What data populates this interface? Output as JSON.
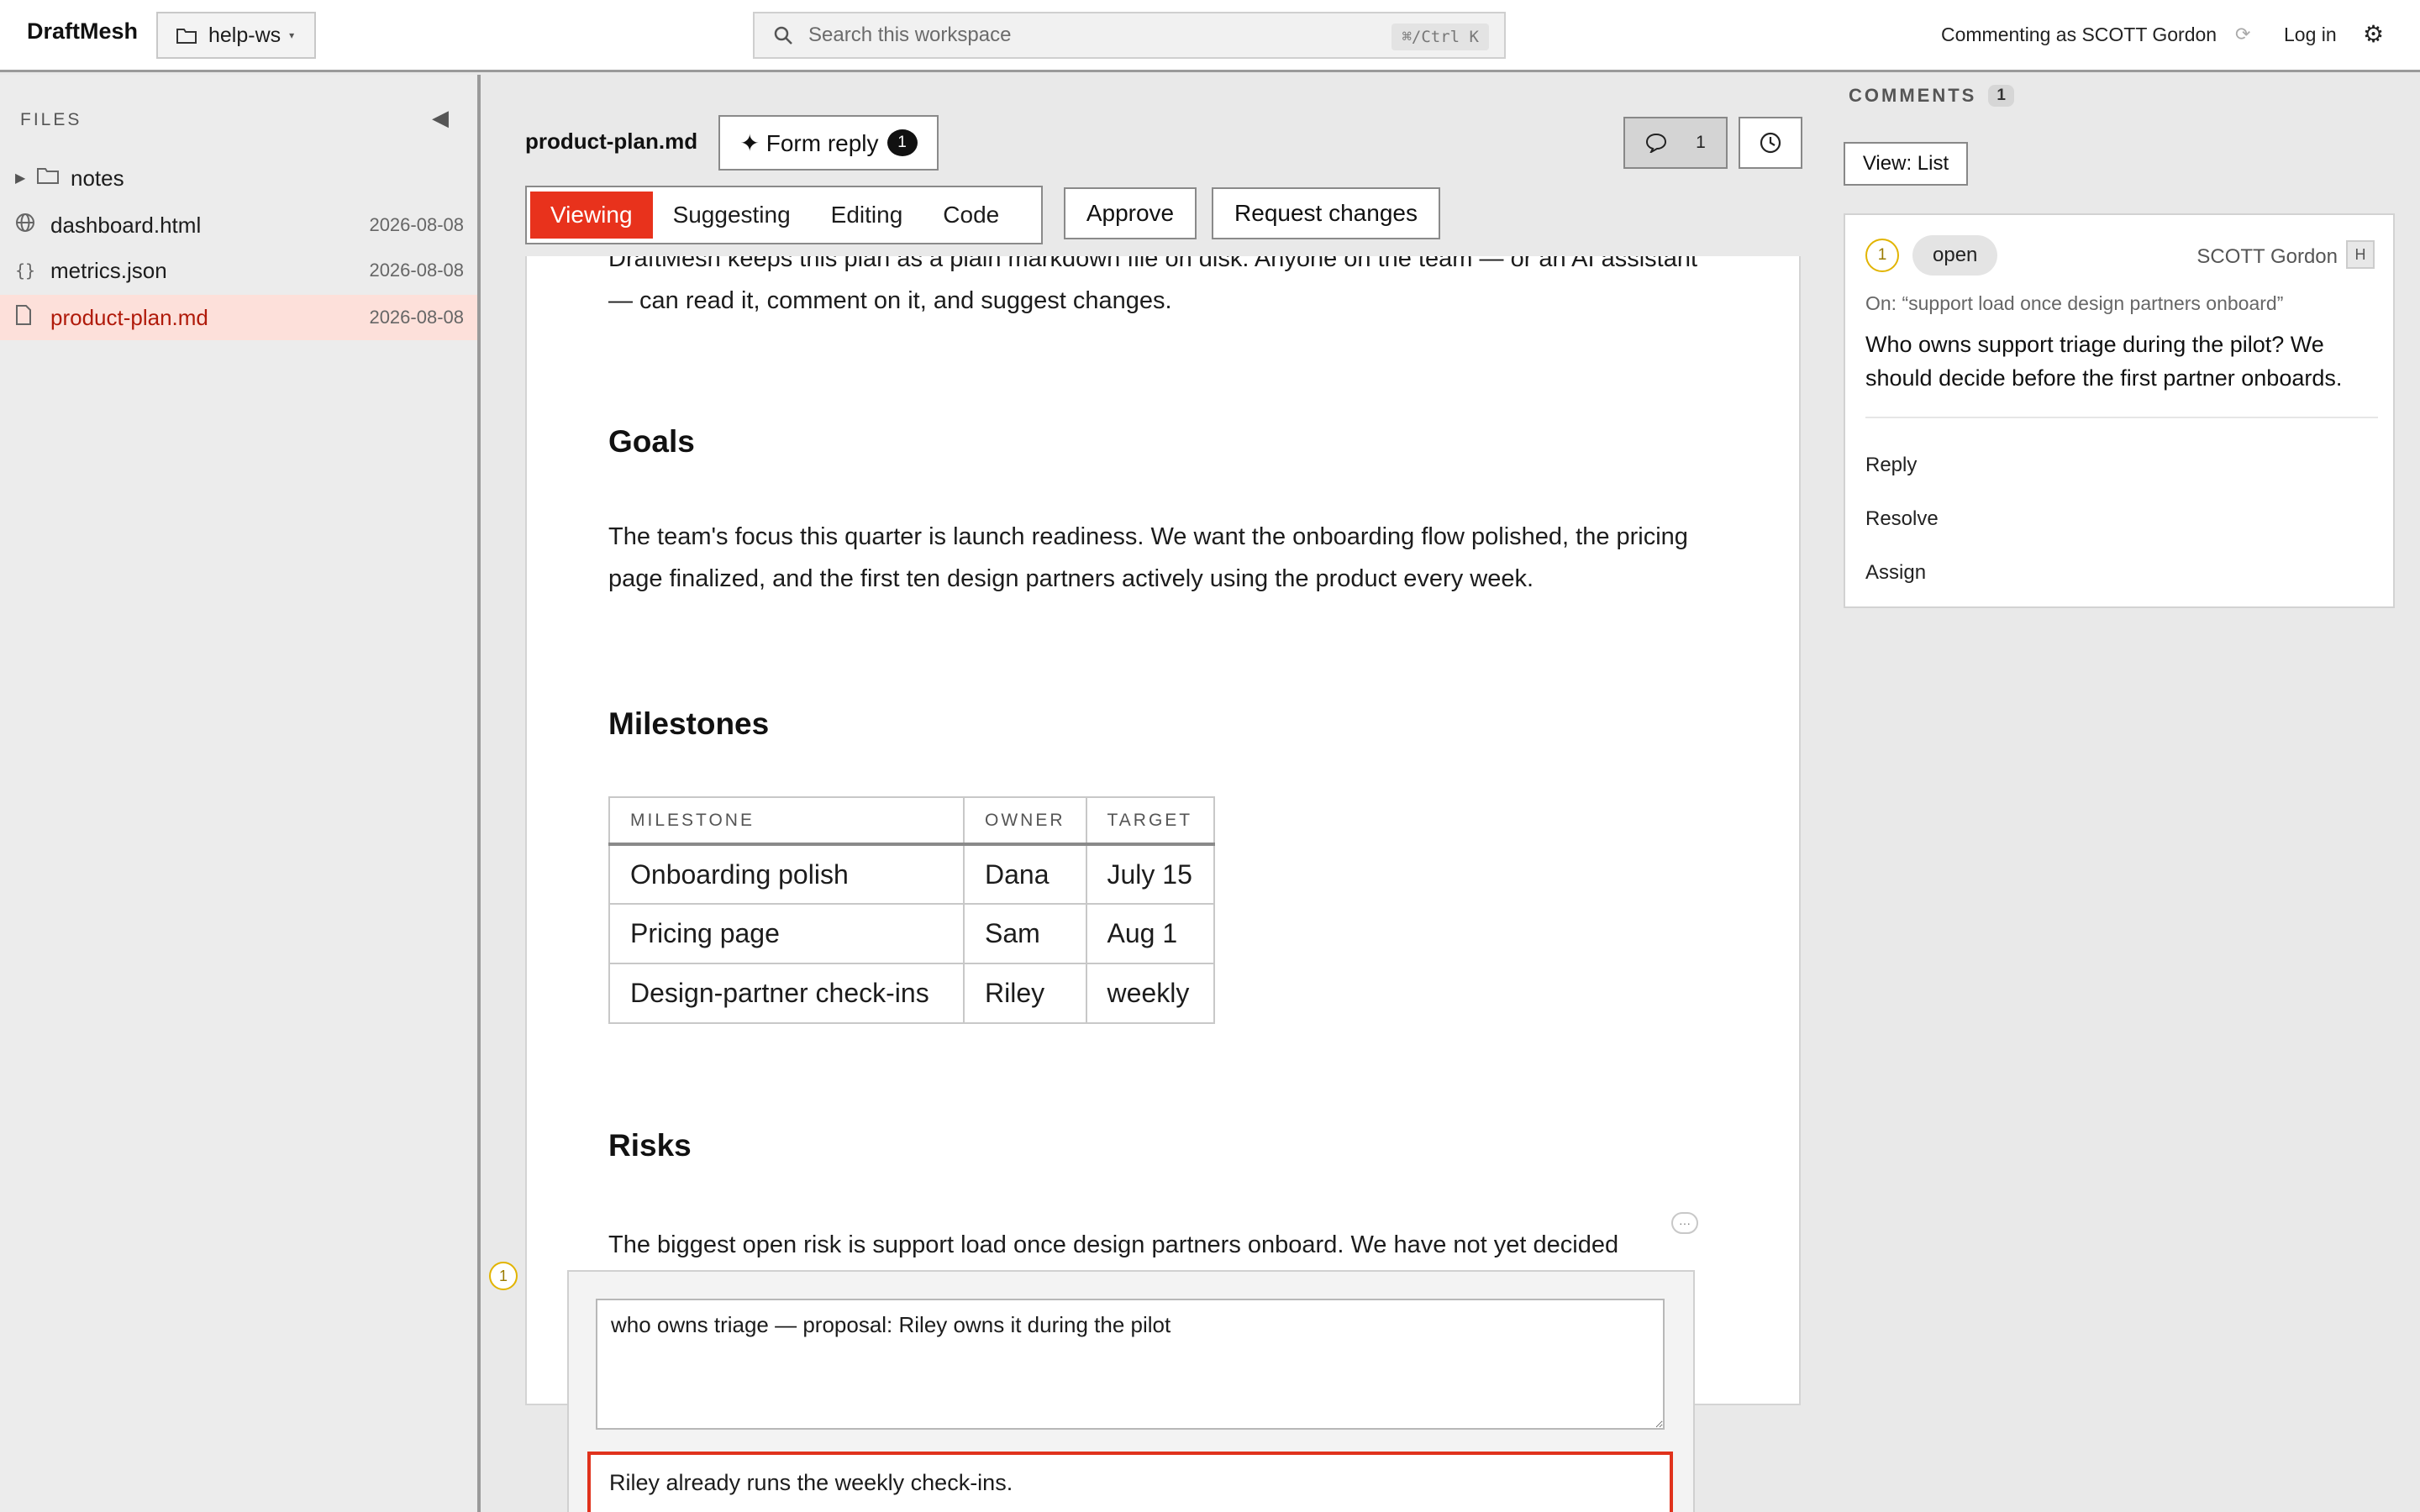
{
  "topbar": {
    "brand": "DraftMesh",
    "workspace": "help-ws",
    "search_placeholder": "Search this workspace",
    "search_shortcut": "⌘/Ctrl K",
    "commenting_as": "Commenting as SCOTT Gordon",
    "login": "Log in"
  },
  "sidebar": {
    "label": "FILES",
    "folder": "notes",
    "files": [
      {
        "name": "dashboard.html",
        "date": "2026-08-08",
        "icon": "globe-icon"
      },
      {
        "name": "metrics.json",
        "date": "2026-08-08",
        "icon": "braces-icon"
      },
      {
        "name": "product-plan.md",
        "date": "2026-08-08",
        "icon": "file-icon",
        "active": true
      }
    ]
  },
  "doc": {
    "title": "product-plan.md",
    "form_reply_label": "✦ Form reply",
    "form_reply_count": "1",
    "comment_count": "1",
    "modes": [
      "Viewing",
      "Suggesting",
      "Editing",
      "Code"
    ],
    "active_mode": "Viewing",
    "approve": "Approve",
    "request_changes": "Request changes",
    "intro": "DraftMesh keeps this plan as a plain markdown file on disk. Anyone on the team — or an AI assistant — can read it, comment on it, and suggest changes.",
    "goals_heading": "Goals",
    "goals_text": "The team's focus this quarter is launch readiness. We want the onboarding flow polished, the pricing page finalized, and the first ten design partners actively using the product every week.",
    "milestones_heading": "Milestones",
    "table": {
      "headers": [
        "MILESTONE",
        "OWNER",
        "TARGET"
      ],
      "rows": [
        [
          "Onboarding polish",
          "Dana",
          "July 15"
        ],
        [
          "Pricing page",
          "Sam",
          "Aug 1"
        ],
        [
          "Design-partner check-ins",
          "Riley",
          "weekly"
        ]
      ]
    },
    "risks_heading": "Risks",
    "risks_text": "The biggest open risk is support load once design partners onboard. We have not yet decided",
    "anchor_num": "1"
  },
  "reply": {
    "textarea_value": "who owns triage — proposal: Riley owns it during the pilot",
    "input_value": "Riley already runs the weekly check-ins."
  },
  "comments": {
    "label": "COMMENTS",
    "count": "1",
    "view": "View: List",
    "card": {
      "num": "1",
      "status": "open",
      "author": "SCOTT Gordon",
      "avatar": "H",
      "on": "On: “support load once design partners onboard”",
      "body": "Who owns support triage during the pilot? We should decide before the first partner onboards.",
      "actions": [
        "Reply",
        "Resolve",
        "Assign"
      ]
    }
  },
  "colors": {
    "accent": "#e8321c",
    "active_file_bg": "#fde0da",
    "anchor": "#e2b400"
  }
}
